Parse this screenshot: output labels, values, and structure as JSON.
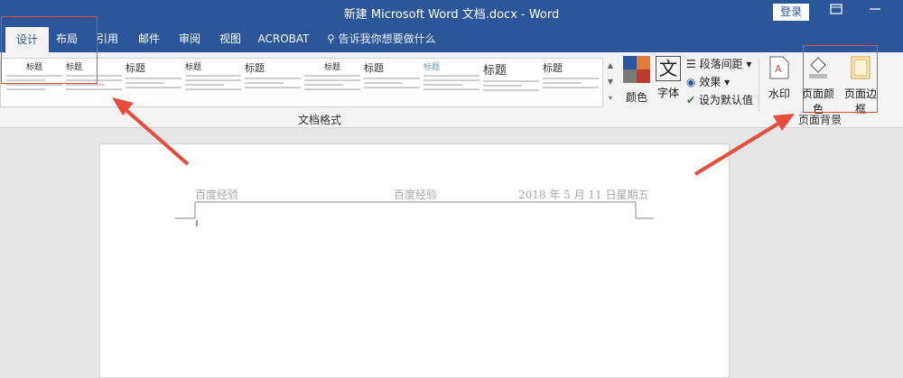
{
  "window": {
    "title": "新建 Microsoft Word 文档.docx - Word",
    "login": "登录",
    "restore_icon": "restore-icon",
    "minimize_icon": "minimize-icon"
  },
  "tabs": [
    {
      "label": "设计",
      "active": true
    },
    {
      "label": "布局"
    },
    {
      "label": "引用"
    },
    {
      "label": "邮件"
    },
    {
      "label": "审阅"
    },
    {
      "label": "视图"
    },
    {
      "label": "ACROBAT"
    }
  ],
  "tell_me": "告诉我你想要做什么",
  "style_gallery": [
    {
      "title": "标题"
    },
    {
      "title": "标题"
    },
    {
      "title": "标题"
    },
    {
      "title": "标题"
    },
    {
      "title": "标题"
    },
    {
      "title": "标题"
    },
    {
      "title": "标题"
    },
    {
      "title": "标题"
    },
    {
      "title": "标题"
    },
    {
      "title": "标题"
    }
  ],
  "doc_format_group": "文档格式",
  "buttons": {
    "colors": "颜色",
    "fonts": "字体",
    "fonts_glyph": "文",
    "paragraph_spacing": "段落间距",
    "effects": "效果",
    "set_default": "设为默认值",
    "watermark": "水印",
    "page_color": "页面颜色",
    "page_borders": "页面边框"
  },
  "page_background_group": "页面背景",
  "header": {
    "left": "百度经验",
    "center": "百度经验",
    "right": "2018 年 5 月 11 日星期五"
  },
  "colors": {
    "accent": "#2b579a",
    "annotation": "#e84c3d"
  }
}
